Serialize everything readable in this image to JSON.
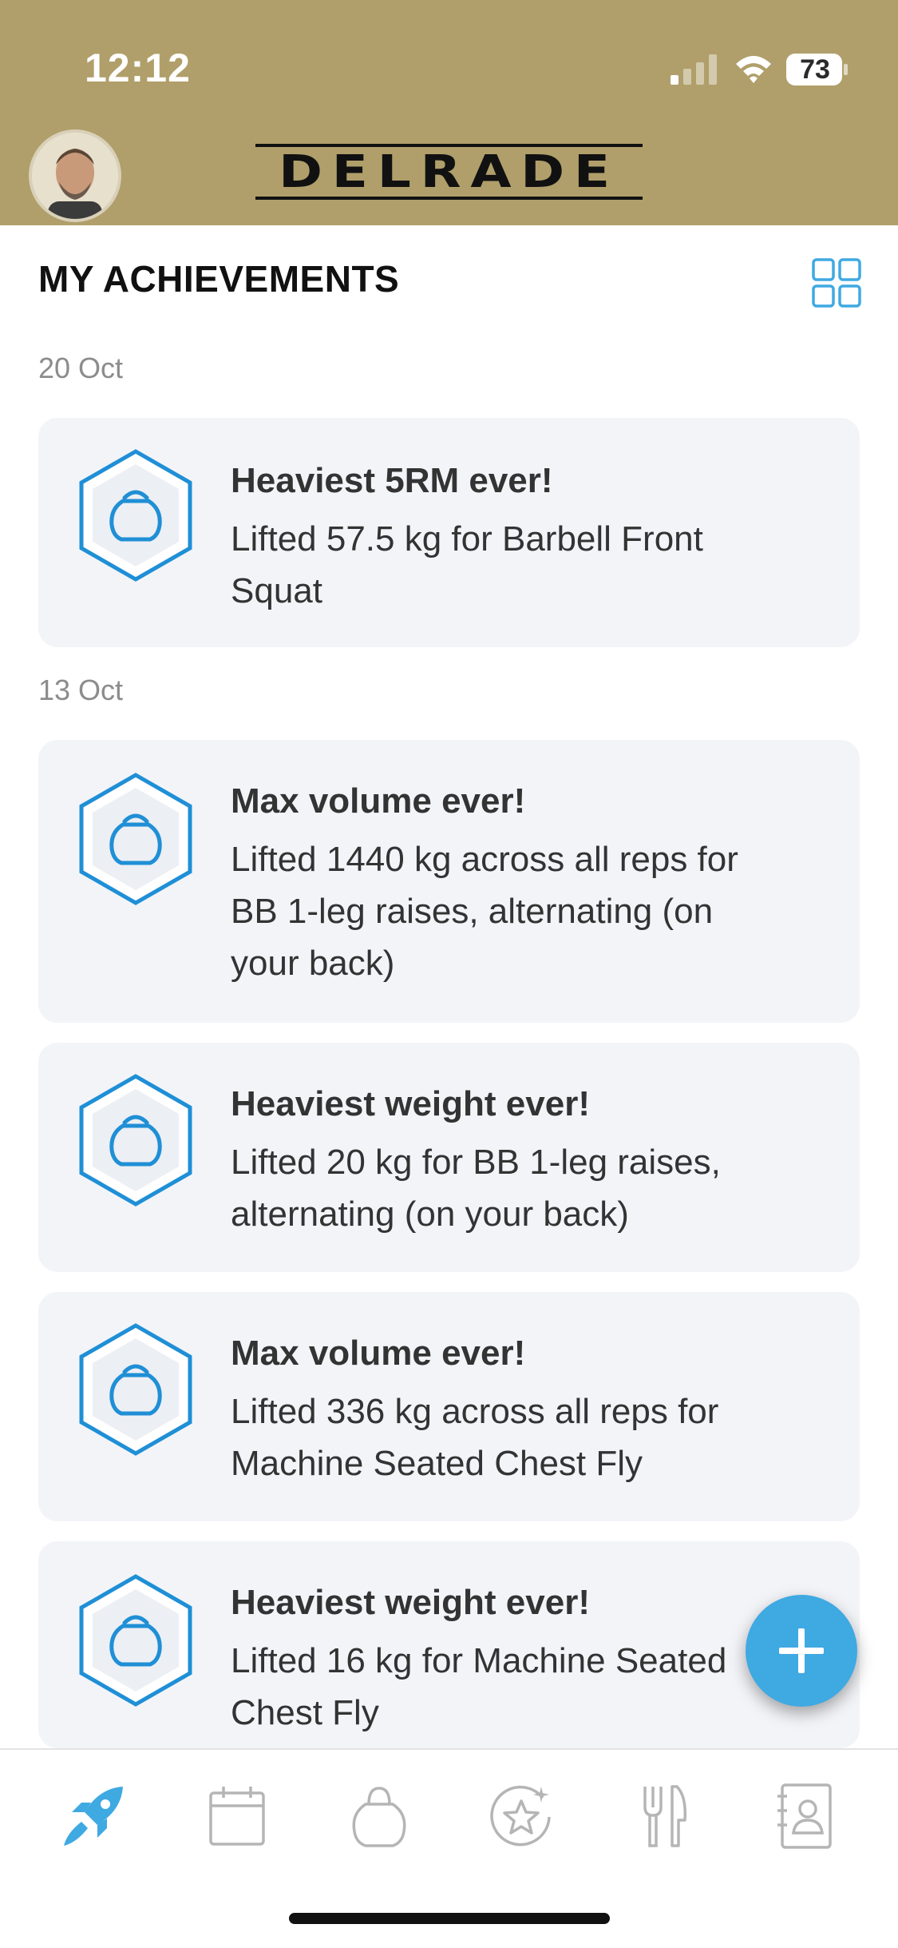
{
  "status_bar": {
    "time": "12:12",
    "battery": "73"
  },
  "header": {
    "logo": "DELRADE",
    "avatar_icon": "user-avatar"
  },
  "page": {
    "title": "MY ACHIEVEMENTS",
    "view_toggle_icon": "grid-icon"
  },
  "groups": [
    {
      "date": "20 Oct",
      "items": [
        {
          "title": "Heaviest 5RM ever!",
          "desc_lines": [
            "Lifted 57.5 kg for Barbell Front",
            "Squat"
          ],
          "icon": "kettlebell-badge-icon"
        }
      ]
    },
    {
      "date": "13 Oct",
      "items": [
        {
          "title": "Max volume ever!",
          "desc_lines": [
            "Lifted 1440 kg across all reps for",
            "BB 1-leg raises, alternating (on",
            "your back)"
          ],
          "icon": "kettlebell-badge-icon"
        },
        {
          "title": "Heaviest weight ever!",
          "desc_lines": [
            "Lifted 20 kg for BB 1-leg raises,",
            "alternating (on your back)"
          ],
          "icon": "kettlebell-badge-icon"
        },
        {
          "title": "Max volume ever!",
          "desc_lines": [
            "Lifted 336 kg across all reps for",
            "Machine Seated Chest Fly"
          ],
          "icon": "kettlebell-badge-icon"
        },
        {
          "title": "Heaviest weight ever!",
          "desc_lines": [
            "Lifted 16 kg for Machine Seated",
            "Chest Fly"
          ],
          "icon": "kettlebell-badge-icon"
        }
      ]
    }
  ],
  "fab": {
    "icon": "plus-icon"
  },
  "tabbar": {
    "tabs": [
      {
        "name": "progress",
        "icon": "rocket-icon",
        "active": true
      },
      {
        "name": "calendar",
        "icon": "calendar-icon",
        "active": false
      },
      {
        "name": "workouts",
        "icon": "kettlebell-icon",
        "active": false
      },
      {
        "name": "achievements",
        "icon": "star-badge-icon",
        "active": false
      },
      {
        "name": "nutrition",
        "icon": "fork-knife-icon",
        "active": false
      },
      {
        "name": "contacts",
        "icon": "contact-book-icon",
        "active": false
      }
    ]
  },
  "colors": {
    "header_bg": "#b09f6a",
    "accent": "#3fa9e2",
    "card_bg": "#f3f4f8",
    "inactive_icon": "#b5b5b5"
  }
}
